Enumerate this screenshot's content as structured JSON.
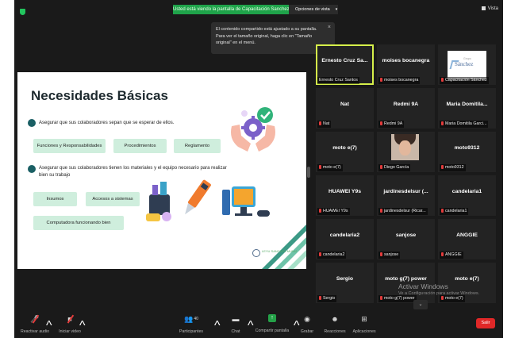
{
  "topbar": {
    "share_banner": "Usted está viendo la pantalla de Capacitación Sanchez",
    "view_options": "Opciones de vista",
    "view_button": "Vista"
  },
  "tooltip": {
    "text": "El contenido compartido está ajustado a su pantalla. Para ver el tamaño original, haga clic en \"Tamaño original\" en el menú."
  },
  "slide": {
    "title": "Necesidades Básicas",
    "bullet1": "Asegurar que sus colaboradores sepan que se esperar de ellos.",
    "chips1": [
      "Funciones y Responsabilidades",
      "Procedimientos",
      "Reglamento"
    ],
    "bullet2": "Asegurar que sus colaboradores tienen los materiales y el equipo necesario para realizar bien su trabajo",
    "chips2": [
      "Insumos",
      "Accesos a sistemas",
      "Computadora funcionando bien"
    ],
    "logo_text": "LEYU SANCHEZ MUNIZ"
  },
  "gallery": [
    {
      "name": "Ernesto Cruz Sa...",
      "label": "Ernesto Cruz Santos",
      "muted": false,
      "active": true,
      "kind": "text"
    },
    {
      "name": "moises bocanegra",
      "label": "moises bocanegra",
      "muted": true,
      "active": false,
      "kind": "text"
    },
    {
      "name": "Sánchez",
      "label": "Capacitación Sánchez",
      "muted": true,
      "active": false,
      "kind": "logo"
    },
    {
      "name": "Nat",
      "label": "Nat",
      "muted": true,
      "active": false,
      "kind": "text"
    },
    {
      "name": "Redmi 9A",
      "label": "Redmi 9A",
      "muted": true,
      "active": false,
      "kind": "text"
    },
    {
      "name": "Maria Domitila...",
      "label": "Maria Domitila Garci...",
      "muted": true,
      "active": false,
      "kind": "text"
    },
    {
      "name": "moto e(7)",
      "label": "moto e(7)",
      "muted": true,
      "active": false,
      "kind": "text"
    },
    {
      "name": "",
      "label": "Diego García",
      "muted": true,
      "active": false,
      "kind": "photo"
    },
    {
      "name": "moto9312",
      "label": "moto9312",
      "muted": true,
      "active": false,
      "kind": "text"
    },
    {
      "name": "HUAWEI Y9s",
      "label": "HUAWEI Y9s",
      "muted": true,
      "active": false,
      "kind": "text"
    },
    {
      "name": "jardinesdelsur (...",
      "label": "jardinesdelsur (Ricar...",
      "muted": true,
      "active": false,
      "kind": "text"
    },
    {
      "name": "candelaria1",
      "label": "candelaria1",
      "muted": true,
      "active": false,
      "kind": "text"
    },
    {
      "name": "candelaria2",
      "label": "candelaria2",
      "muted": true,
      "active": false,
      "kind": "text"
    },
    {
      "name": "sanjose",
      "label": "sanjose",
      "muted": true,
      "active": false,
      "kind": "text"
    },
    {
      "name": "ANGGIE",
      "label": "ANGGIE",
      "muted": true,
      "active": false,
      "kind": "text"
    },
    {
      "name": "Sergio",
      "label": "Sergio",
      "muted": true,
      "active": false,
      "kind": "text"
    },
    {
      "name": "moto g(7) power",
      "label": "moto g(7) power",
      "muted": true,
      "active": false,
      "kind": "text"
    },
    {
      "name": "moto e(7)",
      "label": "moto e(7)",
      "muted": true,
      "active": false,
      "kind": "text"
    }
  ],
  "watermark": {
    "line1": "Activar Windows",
    "line2": "Ve a Configuración para activar Windows."
  },
  "toolbar": {
    "audio": "Reactivar audio",
    "video": "Iniciar video",
    "participants": "Participantes",
    "participants_count": "40",
    "chat": "Chat",
    "share": "Compartir pantalla",
    "record": "Grabar",
    "reactions": "Reacciones",
    "apps": "Aplicaciones",
    "leave": "Salir"
  },
  "colors": {
    "banner_green": "#1fa34a",
    "active_speaker": "#d6f04a",
    "leave_red": "#e02828",
    "slide_bullet": "#1a5f64",
    "chip_bg": "#cfeedd"
  },
  "icons": [
    "shield-icon",
    "grid-icon",
    "close-icon",
    "mic-muted-icon",
    "video-off-icon",
    "participants-icon",
    "chat-icon",
    "share-screen-icon",
    "record-icon",
    "reactions-icon",
    "apps-icon"
  ]
}
